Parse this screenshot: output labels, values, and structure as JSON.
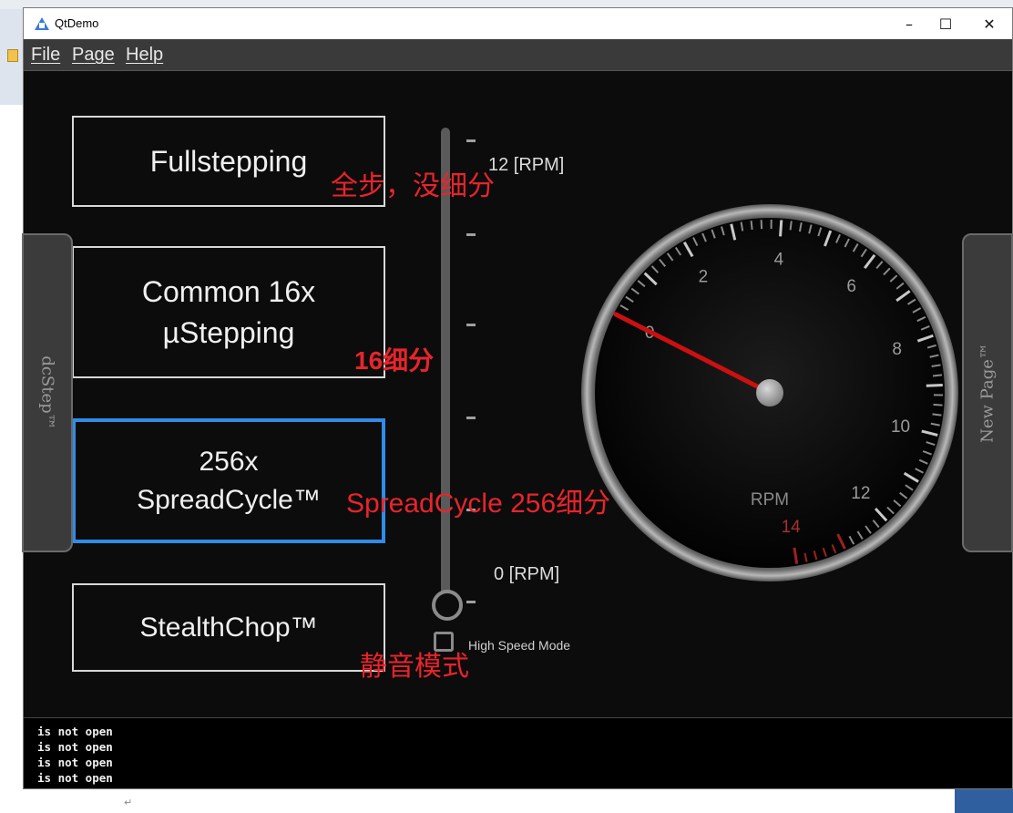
{
  "window": {
    "title": "QtDemo",
    "controls": {
      "minimize": "–",
      "maximize": "☐",
      "close": "✕"
    }
  },
  "menu": [
    {
      "first": "F",
      "rest": "ile"
    },
    {
      "first": "P",
      "rest": "age"
    },
    {
      "first": "H",
      "rest": "elp"
    }
  ],
  "modes": [
    {
      "line1": "Fullstepping",
      "line2": ""
    },
    {
      "line1": "Common 16x",
      "line2": "µStepping"
    },
    {
      "line1": "256x",
      "line2": "SpreadCycle™",
      "active": true
    },
    {
      "line1": "StealthChop™",
      "line2": ""
    }
  ],
  "side_tabs": {
    "left": "dcStep™",
    "right": "New Page™"
  },
  "slider": {
    "max_label": "12 [RPM]",
    "min_label": "0 [RPM]",
    "value_rpm": 0,
    "high_speed_label": "High Speed Mode",
    "high_speed_checked": false
  },
  "annotations": {
    "full": "全步，没细分",
    "common": "16细分",
    "spread": "SpreadCycle 256细分",
    "stealth": "静音模式"
  },
  "gauge": {
    "unit_label": "RPM",
    "min": 0,
    "max": 14,
    "value": 0,
    "labels": [
      "0",
      "2",
      "4",
      "6",
      "8",
      "10",
      "12",
      "14"
    ],
    "red_from": 13
  },
  "log": [
    "is not open",
    "is not open",
    "is not open",
    "is not open"
  ],
  "colors": {
    "accent": "#2f8ce8",
    "annotation": "#e8242b",
    "needle": "#cc1010"
  }
}
